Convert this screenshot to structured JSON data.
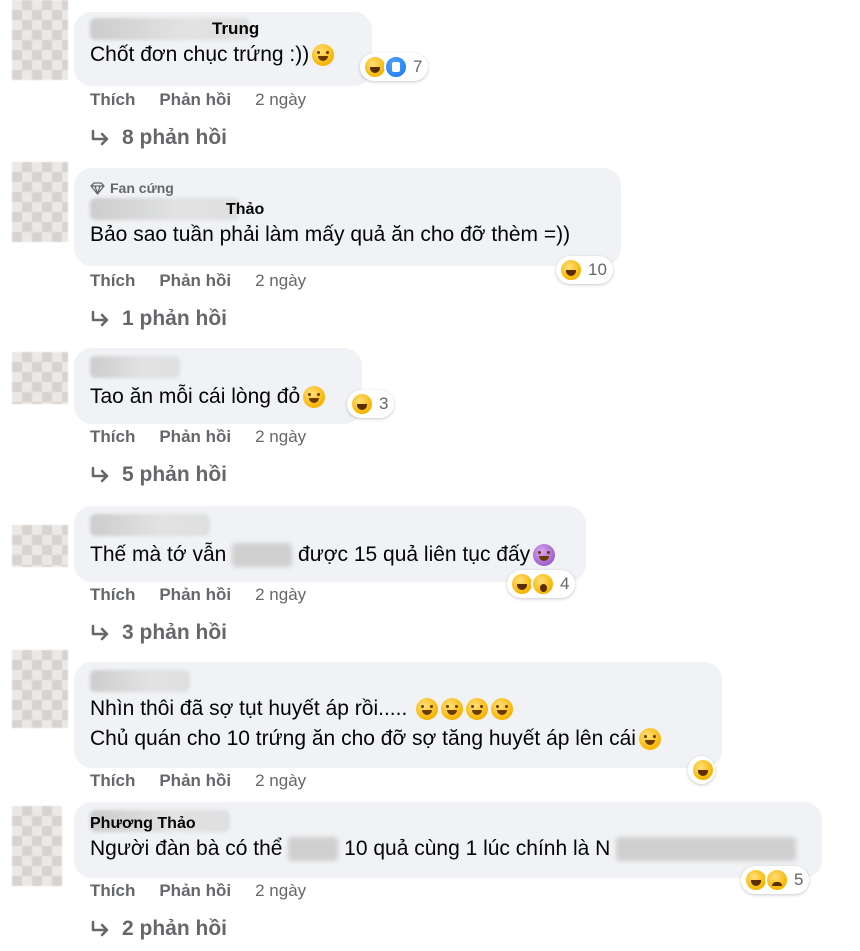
{
  "comments": [
    {
      "name_visible": "Trung",
      "text": "Chốt đơn chục trứng :))",
      "reaction_count": "7",
      "like": "Thích",
      "reply": "Phản hồi",
      "time": "2 ngày",
      "replies_label": "8 phản hồi"
    },
    {
      "badge": "Fan cứng",
      "name_visible": "Thảo",
      "text": "Bảo sao tuần phải làm mấy quả ăn cho đỡ thèm =))",
      "reaction_count": "10",
      "like": "Thích",
      "reply": "Phản hồi",
      "time": "2 ngày",
      "replies_label": "1 phản hồi"
    },
    {
      "text": "Tao ăn mỗi cái lòng đỏ",
      "reaction_count": "3",
      "like": "Thích",
      "reply": "Phản hồi",
      "time": "2 ngày",
      "replies_label": "5 phản hồi"
    },
    {
      "text_before": "Thế mà tớ vẫn",
      "text_after": "được 15 quả liên tục đấy",
      "reaction_count": "4",
      "like": "Thích",
      "reply": "Phản hồi",
      "time": "2 ngày",
      "replies_label": "3 phản hồi"
    },
    {
      "line1": "Nhìn thôi đã sợ tụt huyết áp rồi.....",
      "line2": "Chủ quán cho 10 trứng ăn cho đỡ sợ tăng huyết áp lên cái",
      "like": "Thích",
      "reply": "Phản hồi",
      "time": "2 ngày"
    },
    {
      "name_visible": "Phương Thảo",
      "text_before": "Người đàn bà có thể",
      "text_after": "10 quả cùng 1 lúc chính là N",
      "reaction_count": "5",
      "like": "Thích",
      "reply": "Phản hồi",
      "time": "2 ngày",
      "replies_label": "2 phản hồi"
    }
  ],
  "icons": {
    "reply_arrow": "reply-arrow-icon",
    "badge": "diamond-icon",
    "reaction_haha": "haha-reaction-icon",
    "reaction_like": "like-reaction-icon"
  },
  "colors": {
    "bubble": "#f0f2f5",
    "meta": "#65676b",
    "text": "#050505"
  }
}
